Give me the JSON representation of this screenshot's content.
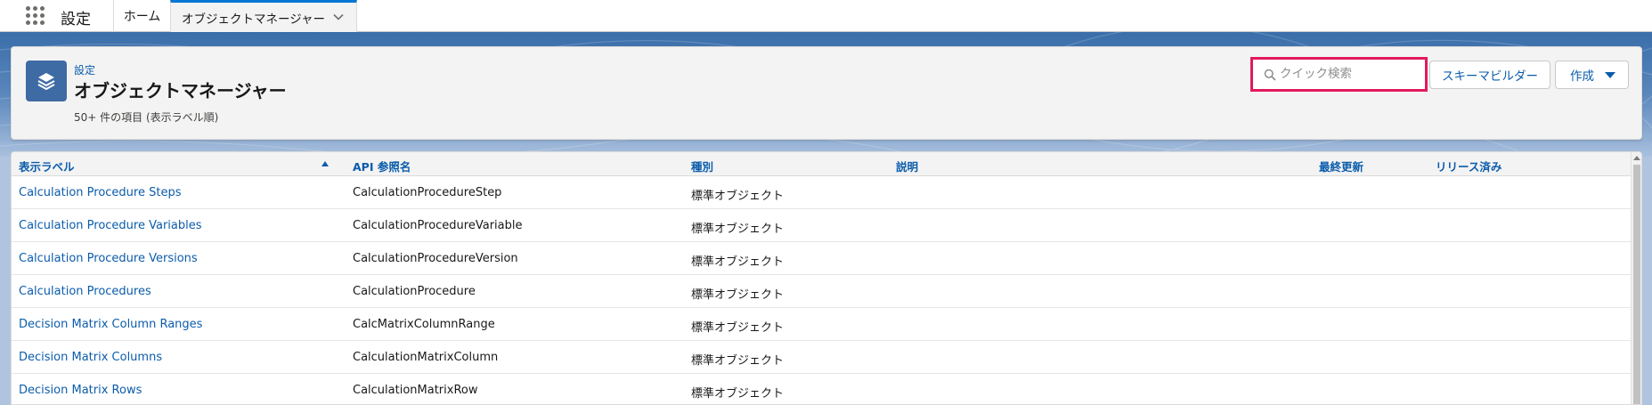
{
  "nav": {
    "app_name": "設定",
    "tabs": [
      {
        "label": "ホーム"
      },
      {
        "label": "オブジェクトマネージャー"
      }
    ]
  },
  "header": {
    "breadcrumb": "設定",
    "title": "オブジェクトマネージャー",
    "subtitle": "50+ 件の項目 (表示ラベル順)",
    "search_placeholder": "クイック検索",
    "schema_builder_label": "スキーマビルダー",
    "create_label": "作成"
  },
  "table": {
    "columns": [
      "表示ラベル",
      "API 参照名",
      "種別",
      "説明",
      "最終更新",
      "リリース済み"
    ],
    "rows": [
      {
        "label": "Calculation Procedure Steps",
        "api": "CalculationProcedureStep",
        "type": "標準オブジェクト",
        "description": "",
        "modified": "",
        "deployed": ""
      },
      {
        "label": "Calculation Procedure Variables",
        "api": "CalculationProcedureVariable",
        "type": "標準オブジェクト",
        "description": "",
        "modified": "",
        "deployed": ""
      },
      {
        "label": "Calculation Procedure Versions",
        "api": "CalculationProcedureVersion",
        "type": "標準オブジェクト",
        "description": "",
        "modified": "",
        "deployed": ""
      },
      {
        "label": "Calculation Procedures",
        "api": "CalculationProcedure",
        "type": "標準オブジェクト",
        "description": "",
        "modified": "",
        "deployed": ""
      },
      {
        "label": "Decision Matrix Column Ranges",
        "api": "CalcMatrixColumnRange",
        "type": "標準オブジェクト",
        "description": "",
        "modified": "",
        "deployed": ""
      },
      {
        "label": "Decision Matrix Columns",
        "api": "CalculationMatrixColumn",
        "type": "標準オブジェクト",
        "description": "",
        "modified": "",
        "deployed": ""
      },
      {
        "label": "Decision Matrix Rows",
        "api": "CalculationMatrixRow",
        "type": "標準オブジェクト",
        "description": "",
        "modified": "",
        "deployed": ""
      }
    ]
  },
  "colors": {
    "accent": "#0b5cab",
    "highlight": "#e3195d",
    "brand": "#3e6ba3"
  }
}
